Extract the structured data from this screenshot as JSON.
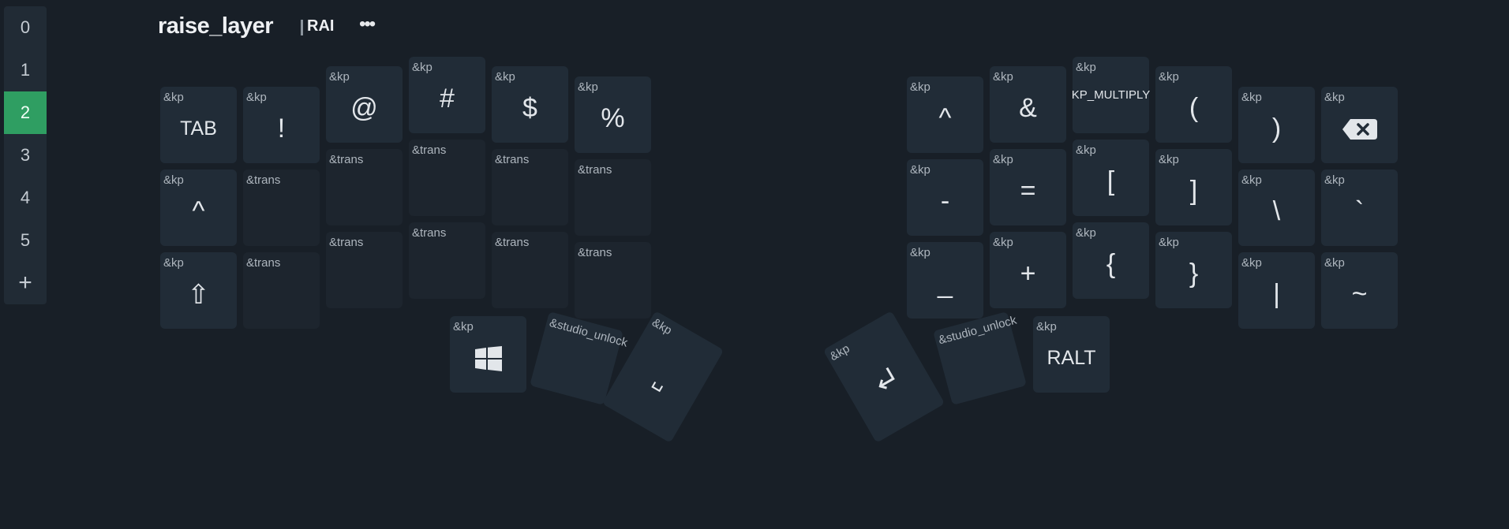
{
  "layers": [
    "0",
    "1",
    "2",
    "3",
    "4",
    "5"
  ],
  "active_layer": "2",
  "add_layer_label": "+",
  "header": {
    "layer_name": "raise_layer",
    "layer_abbrev": "RAI",
    "menu_label": "•••"
  },
  "keys": {
    "tab": {
      "behavior": "&kp",
      "legend": "TAB"
    },
    "excl": {
      "behavior": "&kp",
      "legend": "!"
    },
    "at": {
      "behavior": "&kp",
      "legend": "@"
    },
    "hash": {
      "behavior": "&kp",
      "legend": "#"
    },
    "dollar": {
      "behavior": "&kp",
      "legend": "$"
    },
    "percent": {
      "behavior": "&kp",
      "legend": "%"
    },
    "caret_l": {
      "behavior": "&kp",
      "legend": "^"
    },
    "trans_r2c2": {
      "behavior": "&trans",
      "legend": ""
    },
    "trans_r2c3": {
      "behavior": "&trans",
      "legend": ""
    },
    "trans_r2c4": {
      "behavior": "&trans",
      "legend": ""
    },
    "trans_r2c5": {
      "behavior": "&trans",
      "legend": ""
    },
    "trans_r2c6": {
      "behavior": "&trans",
      "legend": ""
    },
    "shift": {
      "behavior": "&kp",
      "legend": "⇧"
    },
    "trans_r3c2": {
      "behavior": "&trans",
      "legend": ""
    },
    "trans_r3c3": {
      "behavior": "&trans",
      "legend": ""
    },
    "trans_r3c4": {
      "behavior": "&trans",
      "legend": ""
    },
    "trans_r3c5": {
      "behavior": "&trans",
      "legend": ""
    },
    "trans_r3c6": {
      "behavior": "&trans",
      "legend": ""
    },
    "gui": {
      "behavior": "&kp",
      "legend": "windows-icon"
    },
    "unlock_l": {
      "behavior": "&studio_unlock",
      "legend": ""
    },
    "space": {
      "behavior": "&kp",
      "legend": "␣"
    },
    "caret_r": {
      "behavior": "&kp",
      "legend": "^"
    },
    "amp": {
      "behavior": "&kp",
      "legend": "&"
    },
    "multiply": {
      "behavior": "&kp",
      "legend": "KP_MULTIPLY"
    },
    "lparen": {
      "behavior": "&kp",
      "legend": "("
    },
    "rparen": {
      "behavior": "&kp",
      "legend": ")"
    },
    "backspace": {
      "behavior": "&kp",
      "legend": "backspace-icon"
    },
    "minus": {
      "behavior": "&kp",
      "legend": "-"
    },
    "equal": {
      "behavior": "&kp",
      "legend": "="
    },
    "lbracket": {
      "behavior": "&kp",
      "legend": "["
    },
    "rbracket": {
      "behavior": "&kp",
      "legend": "]"
    },
    "backslash": {
      "behavior": "&kp",
      "legend": "\\"
    },
    "grave": {
      "behavior": "&kp",
      "legend": "`"
    },
    "underscore": {
      "behavior": "&kp",
      "legend": "_"
    },
    "plus": {
      "behavior": "&kp",
      "legend": "+"
    },
    "lbrace": {
      "behavior": "&kp",
      "legend": "{"
    },
    "rbrace": {
      "behavior": "&kp",
      "legend": "}"
    },
    "pipe": {
      "behavior": "&kp",
      "legend": "|"
    },
    "tilde": {
      "behavior": "&kp",
      "legend": "~"
    },
    "enter": {
      "behavior": "&kp",
      "legend": "enter-icon"
    },
    "unlock_r": {
      "behavior": "&studio_unlock",
      "legend": ""
    },
    "ralt": {
      "behavior": "&kp",
      "legend": "RALT"
    }
  },
  "colors": {
    "background": "#181f27",
    "sidebar": "#212b35",
    "active_layer": "#2f9e62",
    "key": "#212c37",
    "key_trans": "#1d252e"
  }
}
